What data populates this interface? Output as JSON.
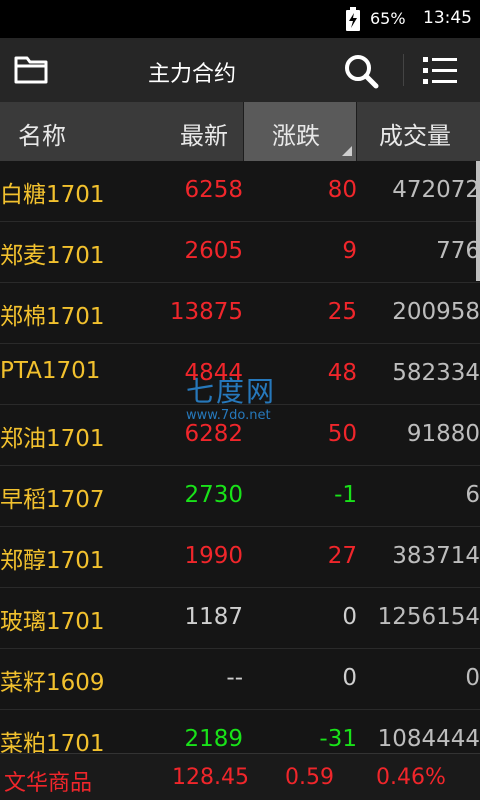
{
  "status_bar": {
    "battery": "65%",
    "time": "13:45"
  },
  "header": {
    "title": "主力合约"
  },
  "columns": {
    "name": "名称",
    "latest": "最新",
    "change": "涨跌",
    "volume": "成交量"
  },
  "rows": [
    {
      "name": "白糖1701",
      "latest": "6258",
      "change": "80",
      "volume": "472072",
      "trend": "up"
    },
    {
      "name": "郑麦1701",
      "latest": "2605",
      "change": "9",
      "volume": "776",
      "trend": "up"
    },
    {
      "name": "郑棉1701",
      "latest": "13875",
      "change": "25",
      "volume": "200958",
      "trend": "up"
    },
    {
      "name": "PTA1701",
      "latest": "4844",
      "change": "48",
      "volume": "582334",
      "trend": "up"
    },
    {
      "name": "郑油1701",
      "latest": "6282",
      "change": "50",
      "volume": "91880",
      "trend": "up"
    },
    {
      "name": "早稻1707",
      "latest": "2730",
      "change": "-1",
      "volume": "6",
      "trend": "down"
    },
    {
      "name": "郑醇1701",
      "latest": "1990",
      "change": "27",
      "volume": "383714",
      "trend": "up"
    },
    {
      "name": "玻璃1701",
      "latest": "1187",
      "change": "0",
      "volume": "1256154",
      "trend": "flat"
    },
    {
      "name": "菜籽1609",
      "latest": "--",
      "change": "0",
      "volume": "0",
      "trend": "flat"
    },
    {
      "name": "菜粕1701",
      "latest": "2189",
      "change": "-31",
      "volume": "1084444",
      "trend": "down"
    }
  ],
  "watermark": {
    "brand": "七度网",
    "site": "www.7do.net"
  },
  "ticker": {
    "name": "文华商品",
    "price": "128.45",
    "change": "0.59",
    "pct": "0.46%"
  },
  "colors": {
    "up": "#f0262b",
    "down": "#19e219",
    "flat": "#cfcfcf",
    "name": "#f2c12e"
  }
}
